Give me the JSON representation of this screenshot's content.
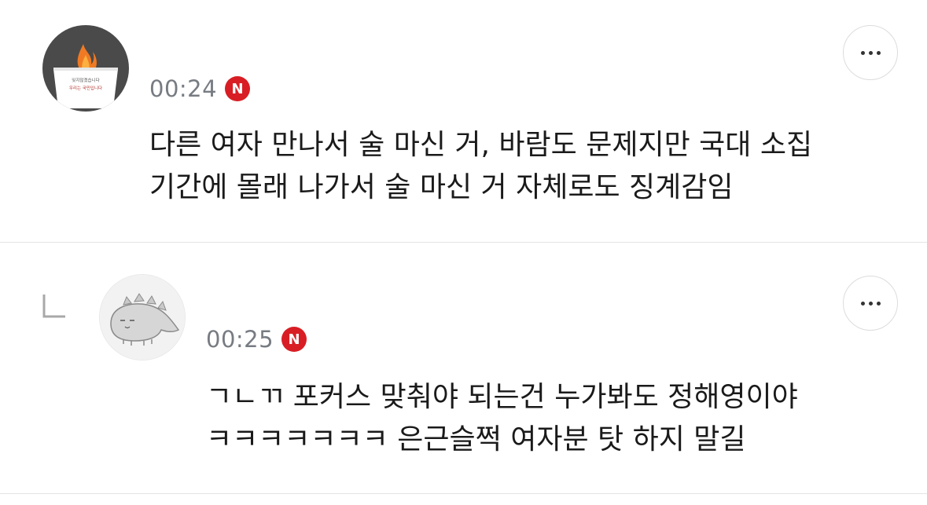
{
  "comments": [
    {
      "time": "00:24",
      "badge": "N",
      "lines": [
        "다른 여자 만나서 술 마신 거, 바람도 문제지만 국대 소집",
        "기간에 몰래 나가서 술 마신 거 자체로도 징계감임"
      ],
      "avatar_text_1": "잊지않겠습니다",
      "avatar_text_2": "우리는 국민입니다"
    },
    {
      "time": "00:25",
      "badge": "N",
      "lines": [
        "ㄱㄴㄲ 포커스 맞춰야 되는건 누가봐도 정해영이야",
        "ㅋㅋㅋㅋㅋㅋㅋ 은근슬쩍 여자분 탓 하지 말길"
      ]
    }
  ],
  "colors": {
    "badge": "#d81e24",
    "time": "#777b82",
    "text": "#1a1a1a",
    "divider": "#e4e4e4"
  },
  "icons": {
    "more": "more-dots-icon",
    "reply": "reply-arrow-icon"
  }
}
